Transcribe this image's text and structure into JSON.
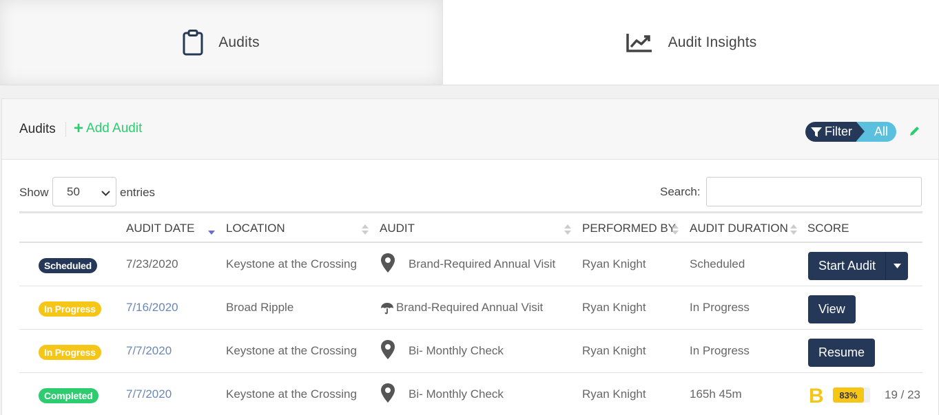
{
  "tabs": [
    {
      "label": "Audits",
      "icon": "clipboard-icon",
      "active": true
    },
    {
      "label": "Audit Insights",
      "icon": "line-chart-icon",
      "active": false
    }
  ],
  "panel": {
    "title": "Audits",
    "add_label": "Add Audit",
    "filter_label": "Filter",
    "filter_value": "All"
  },
  "controls": {
    "show_label": "Show",
    "entries_value": "50",
    "entries_label": "entries",
    "search_label": "Search:",
    "search_value": ""
  },
  "columns": [
    "Audit Date",
    "Location",
    "Audit",
    "Performed By",
    "Audit Duration",
    "Score"
  ],
  "rows": [
    {
      "status": "Scheduled",
      "date": "7/23/2020",
      "location": "Keystone at the Crossing",
      "audit_icon": "map-pin-icon",
      "audit": "Brand-Required Annual Visit",
      "performed_by": "Ryan Knight",
      "duration": "Scheduled",
      "action": "Start Audit"
    },
    {
      "status": "In Progress",
      "date": "7/16/2020",
      "location": "Broad Ripple",
      "audit_icon": "umbrella-icon",
      "audit": "Brand-Required Annual Visit",
      "performed_by": "Ryan Knight",
      "duration": "In Progress",
      "action": "View"
    },
    {
      "status": "In Progress",
      "date": "7/7/2020",
      "location": "Keystone at the Crossing",
      "audit_icon": "map-pin-icon",
      "audit": "Bi- Monthly Check",
      "performed_by": "Ryan Knight",
      "duration": "In Progress",
      "action": "Resume"
    },
    {
      "status": "Completed",
      "date": "7/7/2020",
      "location": "Keystone at the Crossing",
      "audit_icon": "map-pin-icon",
      "audit": "Bi- Monthly Check",
      "performed_by": "Ryan Knight",
      "duration": "165h 45m",
      "grade": "B",
      "percent": "83%",
      "percent_value": 83,
      "fraction": "19 / 23"
    }
  ],
  "colors": {
    "navy": "#253858",
    "green": "#2ecc71",
    "yellow": "#f5c518",
    "cyan": "#5bc0de"
  }
}
